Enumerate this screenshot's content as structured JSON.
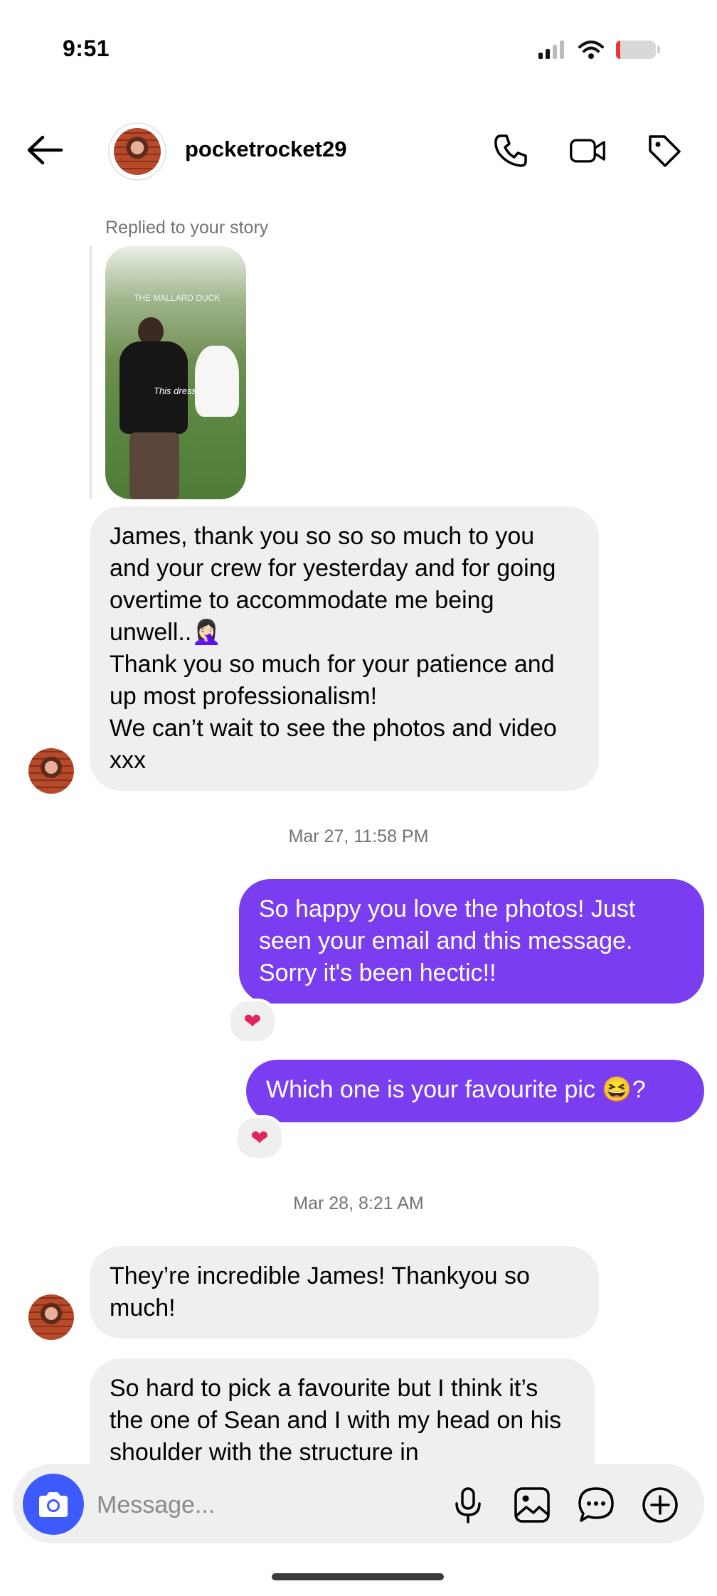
{
  "status_bar": {
    "time": "9:51"
  },
  "header": {
    "username": "pocketrocket29",
    "icons": [
      "back-arrow-icon",
      "phone-icon",
      "video-camera-icon",
      "tag-icon"
    ]
  },
  "story_reply": {
    "label": "Replied to your story",
    "overlay_tag": "THE MALLARD DUCK",
    "overlay_caption": "This dress"
  },
  "messages": {
    "m1": "James, thank you so so so much to you and your crew for yesterday and for going overtime to accommodate me being unwell..🤦🏻‍♀️\nThank you so much for your patience and up most professionalism!\nWe can’t wait to see the photos and video xxx",
    "ts1": "Mar 27, 11:58 PM",
    "m2": "So happy you love the photos! Just seen your email and this message. Sorry it's been hectic!!",
    "m3": "Which one is your favourite pic 😆?",
    "ts2": "Mar 28, 8:21 AM",
    "m4": "They’re incredible James! Thankyou so much!",
    "m5": "So hard to pick a favourite but I think it’s the one of Sean and I with my head on his shoulder with the structure in",
    "reaction": "❤"
  },
  "composer": {
    "placeholder": "Message...",
    "icons": [
      "camera-icon",
      "microphone-icon",
      "gallery-icon",
      "sticker-chat-icon",
      "add-icon"
    ]
  },
  "colors": {
    "outgoing": "#7a3ef0",
    "camera_button": "#3d5afe",
    "incoming": "#efefef"
  }
}
